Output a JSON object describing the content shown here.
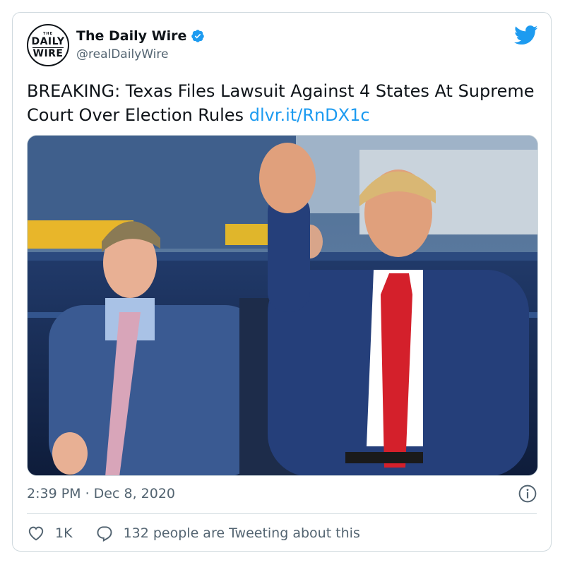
{
  "account": {
    "display_name": "The Daily Wire",
    "handle": "@realDailyWire",
    "avatar_text": {
      "top": "THE",
      "line1": "DAILY",
      "line2": "WIRE"
    }
  },
  "tweet": {
    "text": "BREAKING: Texas Files Lawsuit Against 4 States At Supreme Court Over Election Rules",
    "link": "dlvr.it/RnDX1c",
    "timestamp": "2:39 PM · Dec 8, 2020"
  },
  "engagement": {
    "likes": "1K",
    "replies_text": "132 people are Tweeting about this"
  },
  "icons": {
    "verified": "verified-badge-icon",
    "brand": "twitter-bird-icon",
    "info": "info-icon",
    "like": "heart-icon",
    "reply": "reply-bubble-icon"
  },
  "colors": {
    "accent": "#1d9bf0",
    "text": "#0f1419",
    "muted": "#536471",
    "border": "#cfd9de"
  }
}
